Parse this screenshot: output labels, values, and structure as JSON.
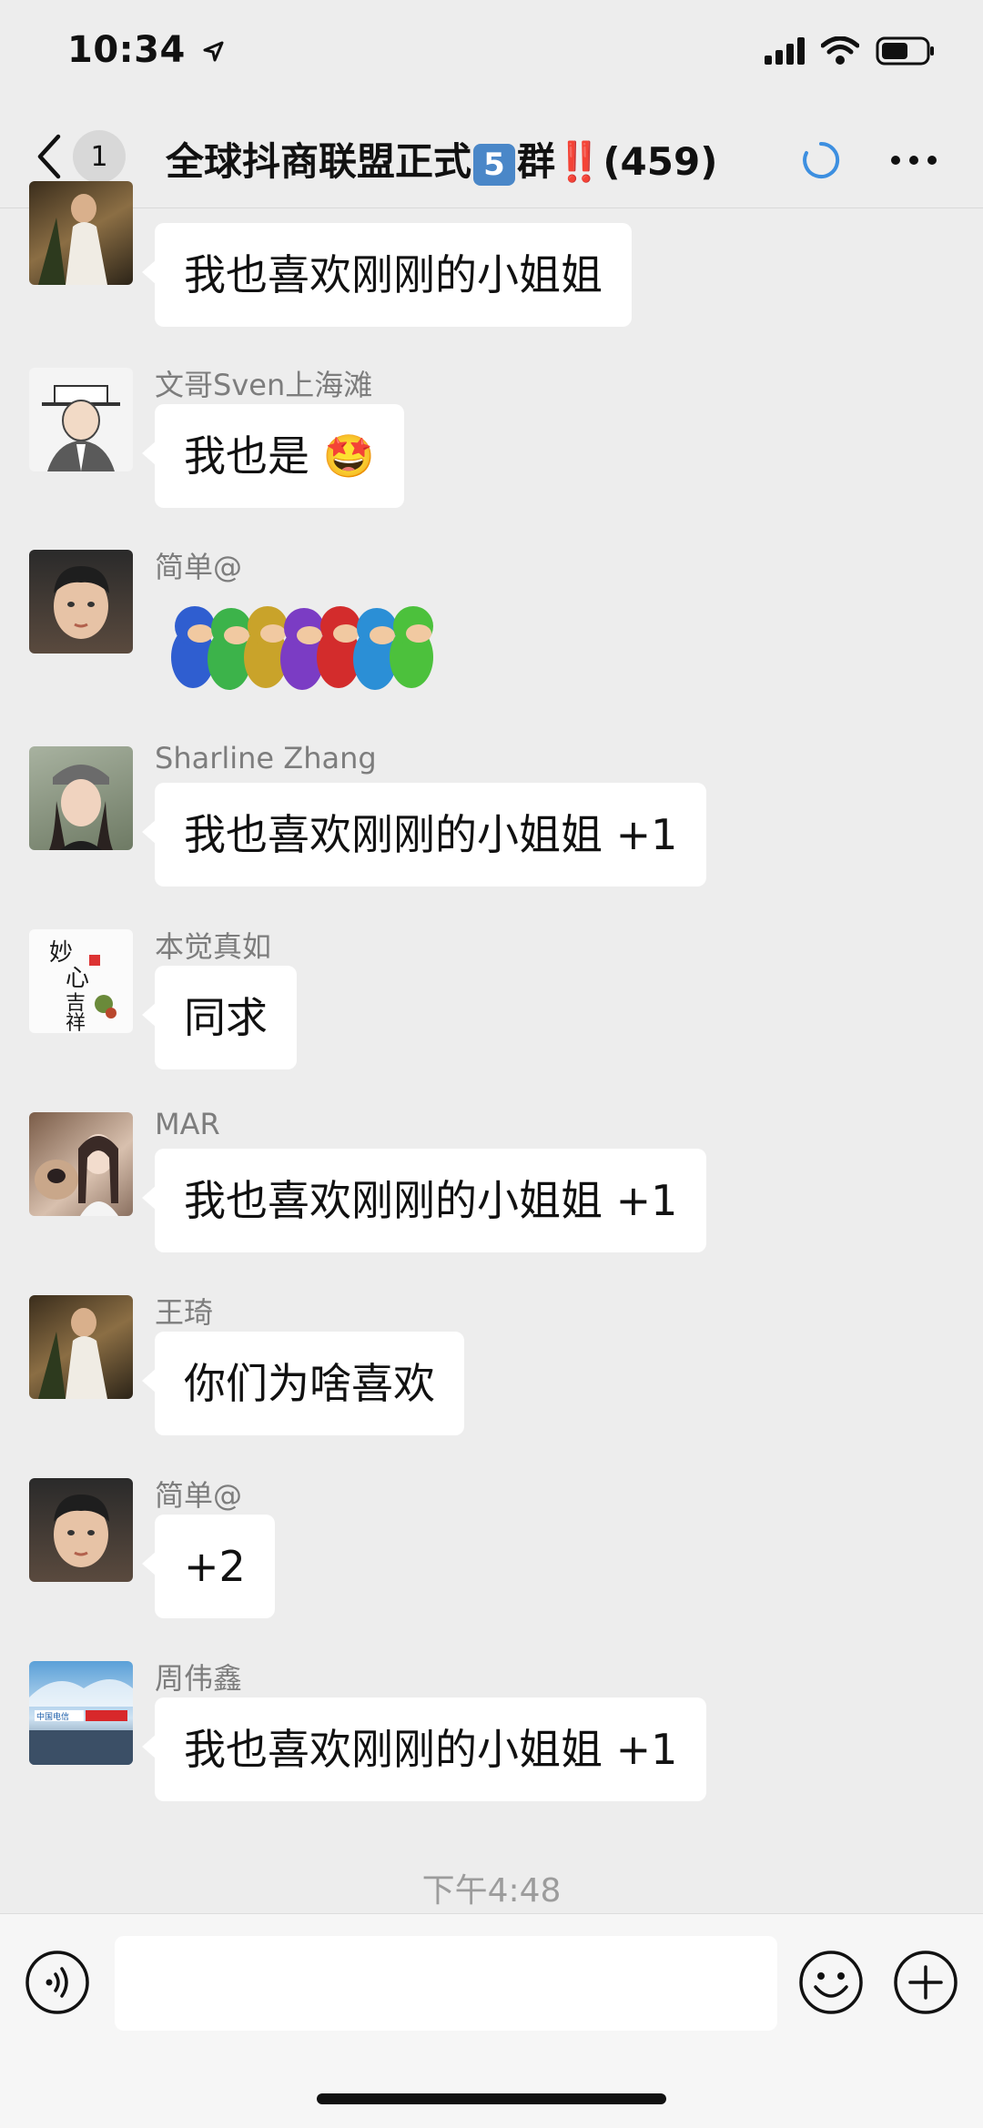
{
  "status": {
    "time": "10:34"
  },
  "nav": {
    "unread": "1",
    "title_main": "全球抖商联盟正式",
    "title_badge": "5",
    "title_group": "群",
    "title_bangs": "‼️",
    "title_count": "(459)"
  },
  "messages": [
    {
      "sender": "",
      "text": "我也喜欢刚刚的小姐姐"
    },
    {
      "sender": "文哥Sven上海滩",
      "text": "我也是",
      "emoji": "🤩"
    },
    {
      "sender": "简单@",
      "sticker": "rainbow-dinosaurs-sticker"
    },
    {
      "sender": "Sharline Zhang",
      "text": "我也喜欢刚刚的小姐姐 +1"
    },
    {
      "sender": "本觉真如",
      "text": "同求",
      "avatar_text": "妙心吉祥"
    },
    {
      "sender": "MAR",
      "text": "我也喜欢刚刚的小姐姐 +1"
    },
    {
      "sender": "王琦",
      "text": "你们为啥喜欢"
    },
    {
      "sender": "简单@",
      "text": "+2"
    },
    {
      "sender": "周伟鑫",
      "text": "我也喜欢刚刚的小姐姐 +1",
      "avatar_text": "中国电信"
    }
  ],
  "timestamp": "下午4:48",
  "input": {
    "value": ""
  },
  "colors": {
    "background": "#ededed",
    "bubble": "#ffffff",
    "accent": "#4a87c8",
    "spinner": "#3d8fe0"
  }
}
